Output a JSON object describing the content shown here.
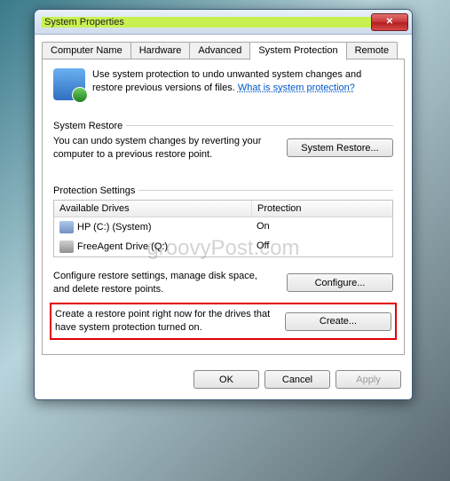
{
  "window": {
    "title": "System Properties"
  },
  "tabs": {
    "computer_name": "Computer Name",
    "hardware": "Hardware",
    "advanced": "Advanced",
    "system_protection": "System Protection",
    "remote": "Remote"
  },
  "intro": {
    "text1": "Use system protection to undo unwanted system changes and restore previous versions of files. ",
    "link": "What is system protection?"
  },
  "system_restore": {
    "legend": "System Restore",
    "desc": "You can undo system changes by reverting your computer to a previous restore point.",
    "button": "System Restore..."
  },
  "protection_settings": {
    "legend": "Protection Settings",
    "col_drives": "Available Drives",
    "col_protection": "Protection",
    "rows": [
      {
        "name": "HP (C:) (System)",
        "protection": "On"
      },
      {
        "name": "FreeAgent Drive (Q:)",
        "protection": "Off"
      }
    ],
    "configure_desc": "Configure restore settings, manage disk space, and delete restore points.",
    "configure_button": "Configure...",
    "create_desc": "Create a restore point right now for the drives that have system protection turned on.",
    "create_button": "Create..."
  },
  "footer": {
    "ok": "OK",
    "cancel": "Cancel",
    "apply": "Apply"
  },
  "watermark": "groovyPost.com"
}
